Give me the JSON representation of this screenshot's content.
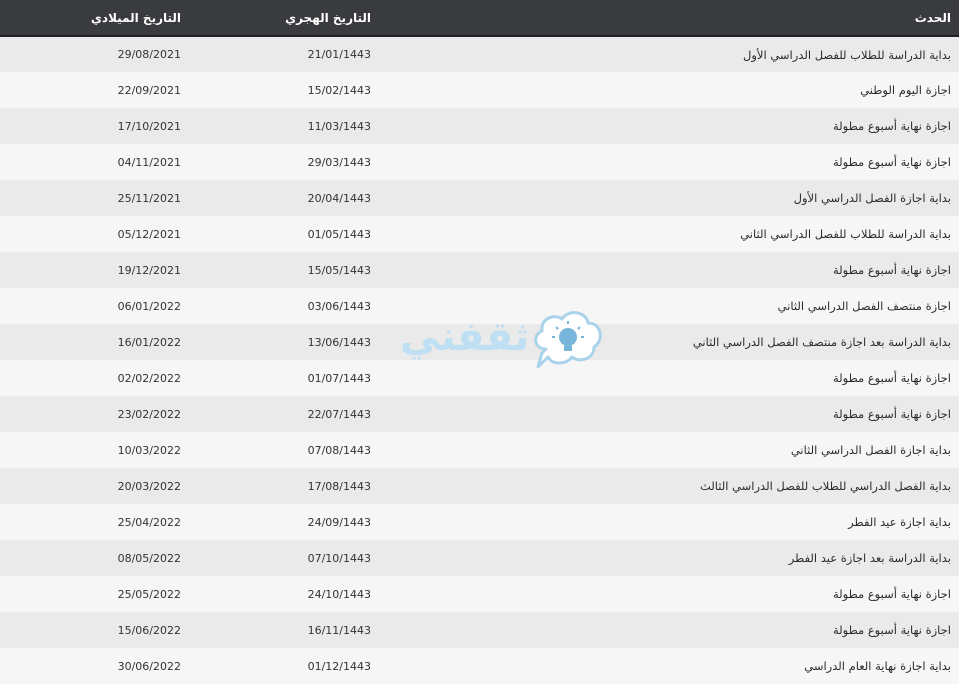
{
  "table": {
    "headers": {
      "event": "الحدث",
      "hijri": "التاريخ الهجري",
      "gregorian": "التاريخ الميلادي"
    },
    "rows": [
      {
        "event": "بداية الدراسة للطلاب للفصل الدراسي الأول",
        "hijri": "21/01/1443",
        "gregorian": "29/08/2021"
      },
      {
        "event": "اجازة اليوم الوطني",
        "hijri": "15/02/1443",
        "gregorian": "22/09/2021"
      },
      {
        "event": "اجازة نهاية أسبوع مطولة",
        "hijri": "11/03/1443",
        "gregorian": "17/10/2021"
      },
      {
        "event": "اجازة نهاية أسبوع مطولة",
        "hijri": "29/03/1443",
        "gregorian": "04/11/2021"
      },
      {
        "event": "بداية اجازة الفصل الدراسي الأول",
        "hijri": "20/04/1443",
        "gregorian": "25/11/2021"
      },
      {
        "event": "بداية الدراسة للطلاب للفصل الدراسي الثاني",
        "hijri": "01/05/1443",
        "gregorian": "05/12/2021"
      },
      {
        "event": "اجازة نهاية أسبوع مطولة",
        "hijri": "15/05/1443",
        "gregorian": "19/12/2021"
      },
      {
        "event": "اجازة منتصف الفصل الدراسي الثاني",
        "hijri": "03/06/1443",
        "gregorian": "06/01/2022"
      },
      {
        "event": "بداية الدراسة بعد اجازة منتصف الفصل الدراسي الثاني",
        "hijri": "13/06/1443",
        "gregorian": "16/01/2022"
      },
      {
        "event": "اجازة نهاية أسبوع مطولة",
        "hijri": "01/07/1443",
        "gregorian": "02/02/2022"
      },
      {
        "event": "اجازة نهاية أسبوع مطولة",
        "hijri": "22/07/1443",
        "gregorian": "23/02/2022"
      },
      {
        "event": "بداية اجازة الفصل الدراسي الثاني",
        "hijri": "07/08/1443",
        "gregorian": "10/03/2022"
      },
      {
        "event": "بداية الفصل الدراسي للطلاب للفصل الدراسي الثالث",
        "hijri": "17/08/1443",
        "gregorian": "20/03/2022"
      },
      {
        "event": "بداية اجازة عيد الفطر",
        "hijri": "24/09/1443",
        "gregorian": "25/04/2022"
      },
      {
        "event": "بداية الدراسة بعد اجازة عيد الفطر",
        "hijri": "07/10/1443",
        "gregorian": "08/05/2022"
      },
      {
        "event": "اجازة نهاية أسبوع مطولة",
        "hijri": "24/10/1443",
        "gregorian": "25/05/2022"
      },
      {
        "event": "اجازة نهاية أسبوع مطولة",
        "hijri": "16/11/1443",
        "gregorian": "15/06/2022"
      },
      {
        "event": "بداية اجازة نهاية العام الدراسي",
        "hijri": "01/12/1443",
        "gregorian": "30/06/2022"
      }
    ]
  },
  "watermark": {
    "text": "ثقفني",
    "icon": "lightbulb-cloud-icon",
    "color": "#bfe0f2"
  },
  "colors": {
    "header_bg": "#3a3b3f",
    "row_odd": "#eaeaea",
    "row_even": "#f6f6f6"
  }
}
